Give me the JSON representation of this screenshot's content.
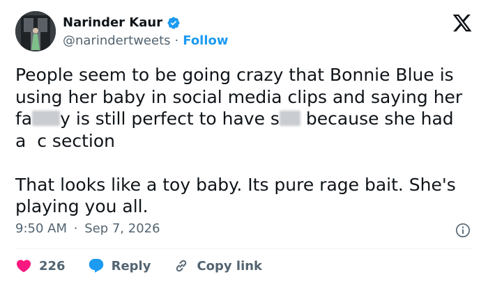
{
  "author": {
    "name": "Narinder Kaur",
    "handle": "@narindertweets",
    "separator": "·",
    "follow_label": "Follow"
  },
  "tweet": {
    "line1": "People seem to be going crazy that Bonnie Blue is using her baby in social media clips and saying her",
    "line2_a": "fa",
    "line2_b": "y is still perfect to have s",
    "line2_c": " because she had",
    "line3_a": "a",
    "line3_b": "c section",
    "paragraph2": "That looks like a toy baby. Its pure rage bait. She's playing you all."
  },
  "meta": {
    "time": "9:50 AM",
    "separator": "·",
    "date": "Sep 7, 2026"
  },
  "actions": {
    "like_count": "226",
    "reply_label": "Reply",
    "copy_label": "Copy link"
  },
  "colors": {
    "accent": "#1d9bf0",
    "like": "#f91880",
    "text": "#0f1419",
    "muted": "#536471"
  },
  "icons": [
    "verified-badge-icon",
    "x-logo-icon",
    "info-icon",
    "heart-icon",
    "reply-bubble-icon",
    "link-icon"
  ]
}
